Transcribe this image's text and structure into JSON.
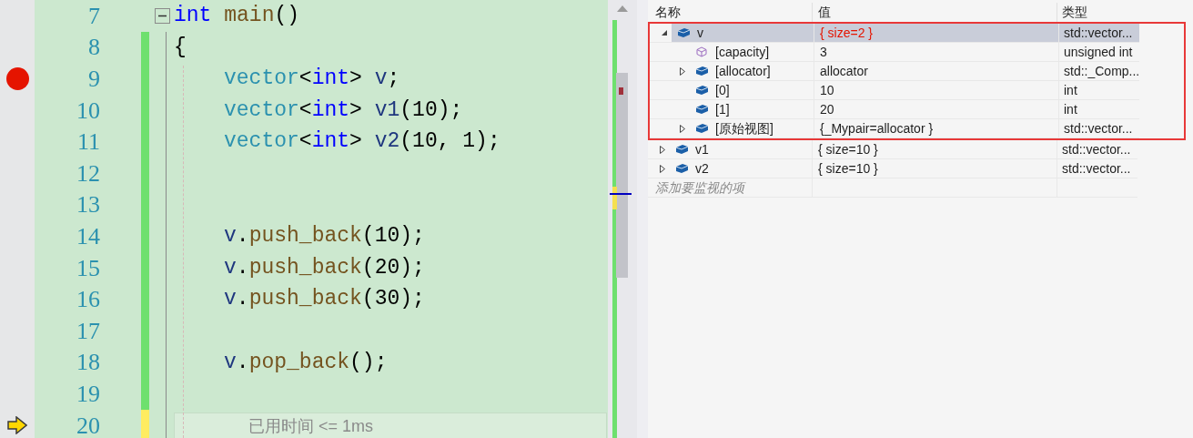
{
  "editor": {
    "lines": [
      {
        "number": "7",
        "breakpoint": false,
        "current": false,
        "modified": false,
        "expanded": true,
        "tokens": [
          {
            "kind": "keyword",
            "text": "int"
          },
          {
            "kind": "func",
            "text": " main"
          },
          {
            "kind": "plain",
            "text": "()"
          }
        ]
      },
      {
        "number": "8",
        "breakpoint": false,
        "current": false,
        "modified": true,
        "saved": true,
        "tokens": [
          {
            "kind": "plain",
            "text": "{"
          }
        ],
        "children": [
          {
            "number": "9",
            "breakpoint": true,
            "current": false,
            "modified": true,
            "saved": true,
            "tokens": [
              {
                "kind": "type",
                "text": "vector"
              },
              {
                "kind": "plain",
                "text": "<"
              },
              {
                "kind": "keyword",
                "text": "int"
              },
              {
                "kind": "plain",
                "text": ">"
              },
              {
                "kind": "ident",
                "text": " v"
              },
              {
                "kind": "plain",
                "text": ";"
              }
            ]
          },
          {
            "number": "10",
            "breakpoint": false,
            "current": false,
            "modified": true,
            "saved": true,
            "tokens": [
              {
                "kind": "type",
                "text": "vector"
              },
              {
                "kind": "plain",
                "text": "<"
              },
              {
                "kind": "keyword",
                "text": "int"
              },
              {
                "kind": "plain",
                "text": ">"
              },
              {
                "kind": "ident",
                "text": " v1"
              },
              {
                "kind": "plain",
                "text": "(10);"
              }
            ]
          },
          {
            "number": "11",
            "breakpoint": false,
            "current": false,
            "modified": true,
            "saved": true,
            "tokens": [
              {
                "kind": "type",
                "text": "vector"
              },
              {
                "kind": "plain",
                "text": "<"
              },
              {
                "kind": "keyword",
                "text": "int"
              },
              {
                "kind": "plain",
                "text": ">"
              },
              {
                "kind": "ident",
                "text": " v2"
              },
              {
                "kind": "plain",
                "text": "(10, 1);"
              }
            ]
          },
          {
            "number": "12",
            "breakpoint": false,
            "current": false,
            "modified": true,
            "saved": true
          },
          {
            "number": "13",
            "breakpoint": false,
            "current": false,
            "modified": true,
            "saved": true
          },
          {
            "number": "14",
            "breakpoint": false,
            "current": false,
            "modified": true,
            "saved": true,
            "tokens": [
              {
                "kind": "ident",
                "text": "v"
              },
              {
                "kind": "plain",
                "text": "."
              },
              {
                "kind": "func",
                "text": "push_back"
              },
              {
                "kind": "plain",
                "text": "(10);"
              }
            ]
          },
          {
            "number": "15",
            "breakpoint": false,
            "current": false,
            "modified": true,
            "saved": true,
            "tokens": [
              {
                "kind": "ident",
                "text": "v"
              },
              {
                "kind": "plain",
                "text": "."
              },
              {
                "kind": "func",
                "text": "push_back"
              },
              {
                "kind": "plain",
                "text": "(20);"
              }
            ]
          },
          {
            "number": "16",
            "breakpoint": false,
            "current": false,
            "modified": true,
            "saved": true,
            "tokens": [
              {
                "kind": "ident",
                "text": "v"
              },
              {
                "kind": "plain",
                "text": "."
              },
              {
                "kind": "func",
                "text": "push_back"
              },
              {
                "kind": "plain",
                "text": "(30);"
              }
            ]
          },
          {
            "number": "17",
            "breakpoint": false,
            "current": false,
            "modified": true,
            "saved": true
          },
          {
            "number": "18",
            "breakpoint": false,
            "current": false,
            "modified": true,
            "saved": true,
            "tokens": [
              {
                "kind": "ident",
                "text": "v"
              },
              {
                "kind": "plain",
                "text": "."
              },
              {
                "kind": "func",
                "text": "pop_back"
              },
              {
                "kind": "plain",
                "text": "();"
              }
            ]
          },
          {
            "number": "19",
            "breakpoint": false,
            "current": false,
            "modified": true,
            "saved": true
          },
          {
            "number": "20",
            "breakpoint": false,
            "current": true,
            "modified": true,
            "saved": false,
            "hint": "已用时间 <= 1ms"
          }
        ]
      }
    ]
  },
  "watch": {
    "columns": [
      "名称",
      "值",
      "类型"
    ],
    "items": [
      {
        "name": "v",
        "value": "{ size=2 }",
        "type": "std::vector...",
        "kind": "object",
        "expanded": true,
        "selected": true,
        "changed": true,
        "highlighted": true,
        "children": [
          {
            "name": "[capacity]",
            "value": "3",
            "type": "unsigned int",
            "kind": "property",
            "selected": false,
            "changed": false
          },
          {
            "name": "[allocator]",
            "value": "allocator",
            "type": "std::_Comp...",
            "kind": "object",
            "expanded": false,
            "selected": false,
            "changed": false
          },
          {
            "name": "[0]",
            "value": "10",
            "type": "int",
            "kind": "object",
            "selected": false,
            "changed": false
          },
          {
            "name": "[1]",
            "value": "20",
            "type": "int",
            "kind": "object",
            "selected": false,
            "changed": false
          },
          {
            "name": "[原始视图]",
            "value": "{_Mypair=allocator }",
            "type": "std::vector...",
            "kind": "object",
            "expanded": false,
            "selected": false,
            "changed": false
          }
        ]
      },
      {
        "name": "v1",
        "value": "{ size=10 }",
        "type": "std::vector...",
        "kind": "object",
        "expanded": false,
        "selected": false,
        "changed": false,
        "highlighted": false
      },
      {
        "name": "v2",
        "value": "{ size=10 }",
        "type": "std::vector...",
        "kind": "object",
        "expanded": false,
        "selected": false,
        "changed": false,
        "highlighted": false
      }
    ],
    "placeholder": "添加要监视的项"
  }
}
